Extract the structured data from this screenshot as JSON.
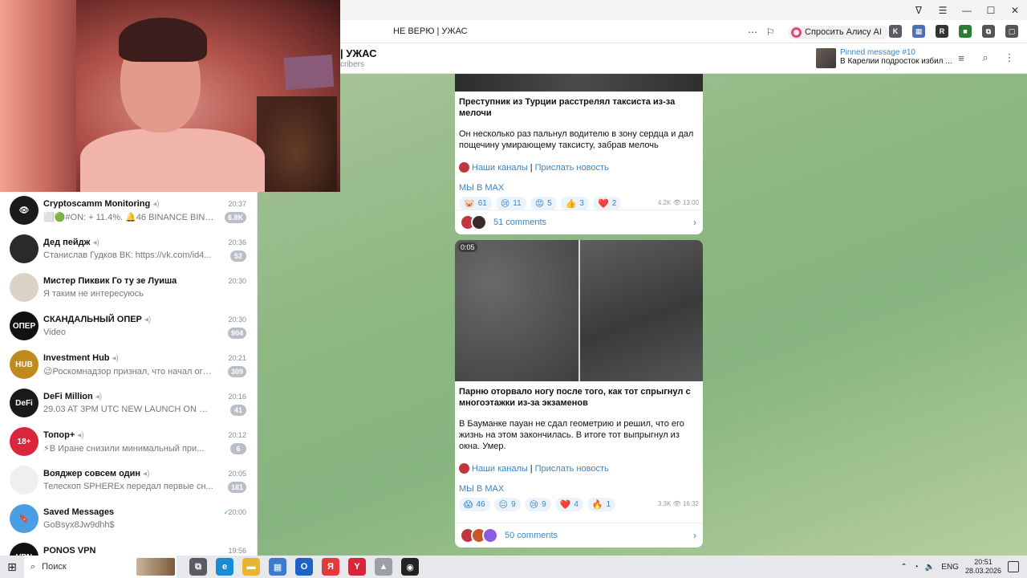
{
  "browser": {
    "page_title": "НЕ ВЕРЮ | УЖАС",
    "alice_label": "Спросить Алису AI",
    "window_controls": [
      "minimize-icon",
      "maximize-icon",
      "close-icon"
    ]
  },
  "channel": {
    "title": "| УЖАС",
    "subtitle": "cribers",
    "pinned_label": "Pinned message #10",
    "pinned_text": "В Карелии подросток избил ..."
  },
  "sidebar": {
    "dialogs": [
      {
        "name": "Cryptoscamm Monitoring",
        "time": "20:37",
        "preview": "⬜🟢#ON: + 11.4%. 🔔46 BINANCE BINGX MEX...",
        "badge": "6.8K",
        "avatar_color": "#1b1b1b",
        "avatar_text": "👁"
      },
      {
        "name": "Дед пейдж",
        "time": "20:36",
        "preview": "Станислав Гудков ВК: https://vk.com/id4...",
        "badge": "52",
        "avatar_color": "#2a2a2a",
        "avatar_text": ""
      },
      {
        "name": "Мистер Пиквик Го ту зе Луиша",
        "time": "20:30",
        "preview": "Я таким не интересуюсь",
        "badge": "",
        "avatar_color": "#d9d3c8",
        "avatar_text": ""
      },
      {
        "name": "СКАНДАЛЬНЫЙ ОПЕР",
        "time": "20:30",
        "preview": "Video",
        "badge": "904",
        "avatar_color": "#111111",
        "avatar_text": "ОПЕР"
      },
      {
        "name": "Investment Hub",
        "time": "20:21",
        "preview": "😉Роскомнадзор признал, что начал огра...",
        "badge": "309",
        "avatar_color": "#c08a1e",
        "avatar_text": "HUB"
      },
      {
        "name": "DeFi Million",
        "time": "20:16",
        "preview": "29.03 AT 3PM UTC NEW LAUNCH ON @de...",
        "badge": "41",
        "avatar_color": "#1a1a1a",
        "avatar_text": "DeFi"
      },
      {
        "name": "Топор+",
        "time": "20:12",
        "preview": "⚡В Иране снизили минимальный при...",
        "badge": "6",
        "avatar_color": "#d8263a",
        "avatar_text": "18+"
      },
      {
        "name": "Вояджер совсем один",
        "time": "20:05",
        "preview": "Телескоп SPHEREx передал первые сн...",
        "badge": "181",
        "avatar_color": "#efefef",
        "avatar_text": ""
      },
      {
        "name": "Saved Messages",
        "time": "20:00",
        "preview": "GoBsyx8Jw9dhh$",
        "badge": "",
        "avatar_color": "#4a9fe4",
        "avatar_text": "🔖"
      },
      {
        "name": "PONOS VPN",
        "time": "19:56",
        "preview": "",
        "badge": "",
        "avatar_color": "#111111",
        "avatar_text": "VPN"
      }
    ]
  },
  "posts": [
    {
      "title": "Преступник из Турции расстрелял таксиста из-за мелочи",
      "body": "Он несколько раз пальнул водителю в зону сердца и дал пощечину умирающему таксисту, забрав мелочь",
      "link1": "Наши каналы",
      "link2": "Прислать новость",
      "max": "МЫ В MAX",
      "reactions": [
        {
          "emoji": "🐷",
          "count": "61"
        },
        {
          "emoji": "😢",
          "count": "11"
        },
        {
          "emoji": "😡",
          "count": "5"
        },
        {
          "emoji": "👍",
          "count": "3"
        },
        {
          "emoji": "❤️",
          "count": "2"
        }
      ],
      "views": "4.2K",
      "time": "13:00",
      "comments": "51 comments"
    },
    {
      "duration": "0:05",
      "title": "Парню оторвало ногу после того, как тот спрыгнул с многоэтажки из-за экзаменов",
      "body": "В Бауманке пауан не сдал геометрию и решил, что его жизнь на этом закончилась. В итоге тот выпрыгнул из окна. Умер.",
      "link1": "Наши каналы",
      "link2": "Прислать новость",
      "max": "МЫ В MAX",
      "reactions": [
        {
          "emoji": "😱",
          "count": "46"
        },
        {
          "emoji": "😐",
          "count": "9"
        },
        {
          "emoji": "😢",
          "count": "9"
        },
        {
          "emoji": "❤️",
          "count": "4"
        },
        {
          "emoji": "🔥",
          "count": "1"
        }
      ],
      "views": "3.3K",
      "time": "16:32",
      "comments": "50 comments"
    }
  ],
  "taskbar": {
    "search_label": "Поиск",
    "lang": "ENG",
    "time": "20:51",
    "date": "28.03.2026"
  }
}
